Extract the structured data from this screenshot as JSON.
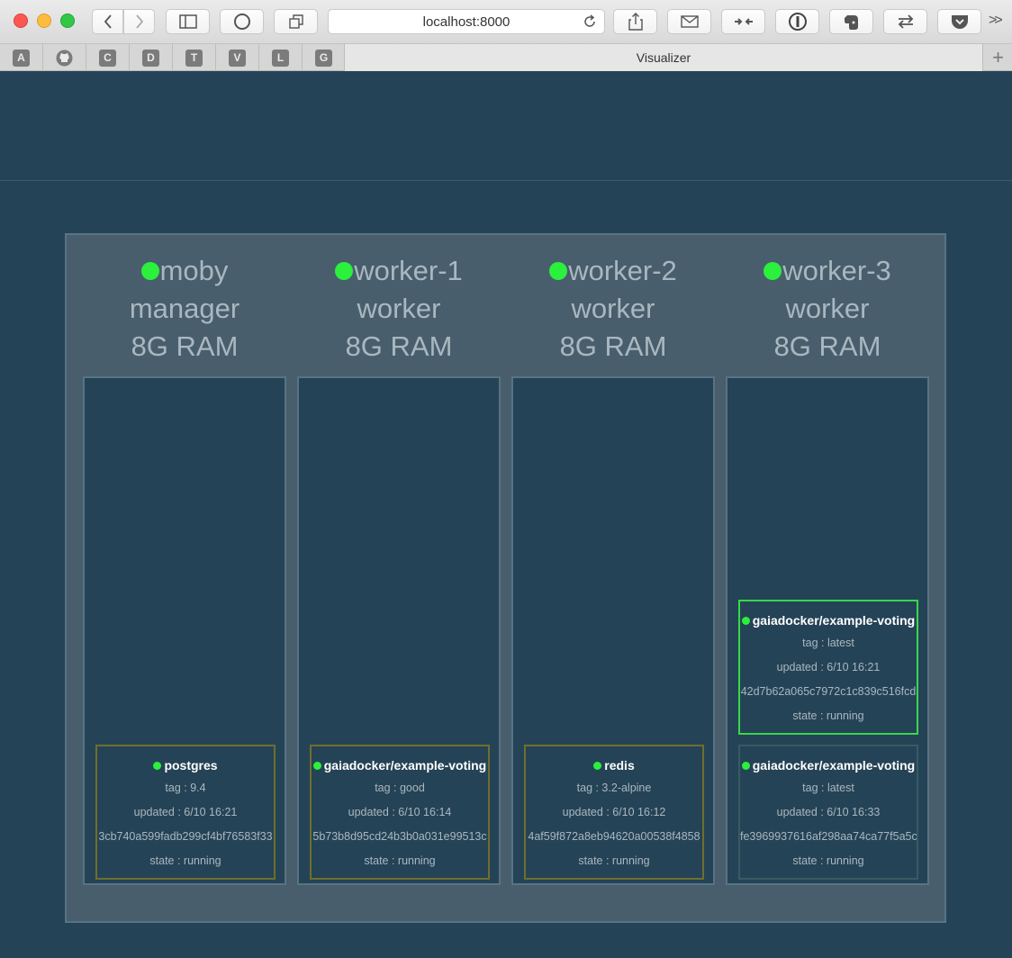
{
  "browser": {
    "url": "localhost:8000",
    "tab_title": "Visualizer",
    "pinned_tabs": [
      "A",
      "",
      "C",
      "D",
      "T",
      "V",
      "L",
      "G"
    ],
    "overflow": ">>",
    "new_tab": "+"
  },
  "nodes": [
    {
      "name": "moby",
      "role": "manager",
      "ram": "8G RAM",
      "tasks": [
        {
          "name": "postgres",
          "tag": "tag : 9.4",
          "updated": "updated : 6/10 16:21",
          "id": "3cb740a599fadb299cf4bf76583f33",
          "state": "state : running"
        }
      ]
    },
    {
      "name": "worker-1",
      "role": "worker",
      "ram": "8G RAM",
      "tasks": [
        {
          "name": "gaiadocker/example-voting",
          "tag": "tag : good",
          "updated": "updated : 6/10 16:14",
          "id": "5b73b8d95cd24b3b0a031e99513c",
          "state": "state : running"
        }
      ]
    },
    {
      "name": "worker-2",
      "role": "worker",
      "ram": "8G RAM",
      "tasks": [
        {
          "name": "redis",
          "tag": "tag : 3.2-alpine",
          "updated": "updated : 6/10 16:12",
          "id": "4af59f872a8eb94620a00538f4858",
          "state": "state : running"
        }
      ]
    },
    {
      "name": "worker-3",
      "role": "worker",
      "ram": "8G RAM",
      "tasks": [
        {
          "name": "gaiadocker/example-voting",
          "tag": "tag : latest",
          "updated": "updated : 6/10 16:21",
          "id": "42d7b62a065c7972c1c839c516fcd",
          "state": "state : running"
        },
        {
          "name": "gaiadocker/example-voting",
          "tag": "tag : latest",
          "updated": "updated : 6/10 16:33",
          "id": "fe3969937616af298aa74ca77f5a5c",
          "state": "state : running"
        }
      ]
    }
  ],
  "colors": {
    "background": "#254356",
    "cluster": "#485e6c",
    "status_green": "#2bf03c",
    "task_border": "#6f6e2c",
    "task_border_new": "#38d84a"
  }
}
